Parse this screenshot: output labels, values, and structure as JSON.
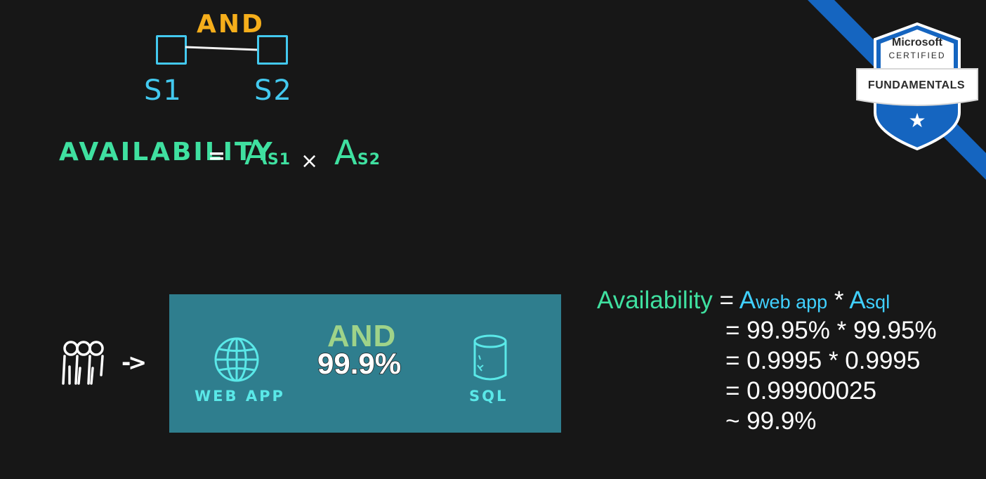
{
  "diagram": {
    "connector_label": "AND",
    "node_1": "S1",
    "node_2": "S2"
  },
  "handwritten_formula": {
    "label": "AVAILABILITY",
    "equals": "=",
    "term_1_base": "A",
    "term_1_sub": "S1",
    "operator": "×",
    "term_2_base": "A",
    "term_2_sub": "S2"
  },
  "architecture": {
    "web_app_label": "WEB APP",
    "connector_label": "AND",
    "combined_sla": "99.9%",
    "sql_label": "SQL",
    "arrow": "->"
  },
  "formula": {
    "label": "Availability",
    "line_1": {
      "eq": "=",
      "a1": "A",
      "a1_sub": "web app",
      "op": "*",
      "a2": "A",
      "a2_sub": "sql"
    },
    "line_2": "= 99.95% * 99.95%",
    "line_3": "= 0.9995 * 0.9995",
    "line_4": "= 0.99900025",
    "line_5": "~ 99.9%"
  },
  "badge": {
    "line_1": "Microsoft",
    "line_2": "CERTIFIED",
    "ribbon": "FUNDAMENTALS",
    "star": "★"
  },
  "colors": {
    "background": "#171717",
    "panel": "#2f7e8e",
    "cyan": "#43c9ef",
    "orange": "#f5ae1b",
    "green": "#3fe0a0",
    "badge_blue": "#1565c0"
  }
}
